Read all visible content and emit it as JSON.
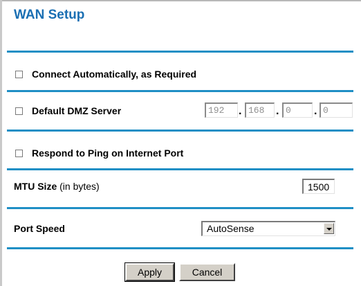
{
  "page": {
    "title": "WAN Setup"
  },
  "options": {
    "connect_auto": {
      "label": "Connect Automatically, as Required",
      "checked": false
    },
    "dmz": {
      "label": "Default DMZ Server",
      "checked": false,
      "ip": [
        "192",
        "168",
        "0",
        "0"
      ]
    },
    "respond_ping": {
      "label": "Respond to Ping on Internet Port",
      "checked": false
    }
  },
  "mtu": {
    "label": "MTU Size",
    "unit": "(in bytes)",
    "value": "1500"
  },
  "port_speed": {
    "label": "Port Speed",
    "selected": "AutoSense"
  },
  "buttons": {
    "apply": "Apply",
    "cancel": "Cancel"
  },
  "colors": {
    "title": "#1a6fb3",
    "divider": "#1f8fc5"
  }
}
